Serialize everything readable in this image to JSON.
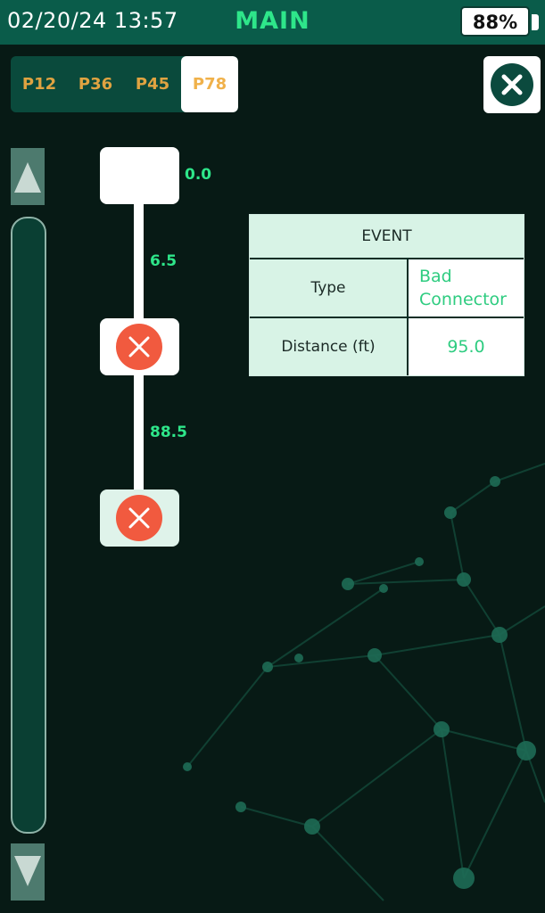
{
  "status_bar": {
    "datetime": "02/20/24 13:57",
    "title": "MAIN",
    "battery": "88%"
  },
  "port_tabs": [
    {
      "label": "P12",
      "active": false
    },
    {
      "label": "P36",
      "active": false
    },
    {
      "label": "P45",
      "active": false
    },
    {
      "label": "P78",
      "active": true
    }
  ],
  "chain": {
    "start_distance": "0.0",
    "segments": [
      "6.5",
      "88.5"
    ],
    "events": [
      {
        "icon": "fault-x-icon"
      },
      {
        "icon": "fault-x-icon"
      }
    ]
  },
  "event_table": {
    "header": "EVENT",
    "rows": [
      {
        "label": "Type",
        "value_line1": "Bad",
        "value_line2": "Connector"
      },
      {
        "label": "Distance (ft)",
        "value": "95.0"
      }
    ]
  },
  "colors": {
    "accent_green": "#2ee68a",
    "fault_red": "#f15a3f",
    "tab_orange": "#e0a341",
    "status_bar": "#0a5c4a"
  },
  "icons": {
    "close": "close-x-icon",
    "scroll_up": "triangle-up-icon",
    "scroll_down": "triangle-down-icon"
  }
}
